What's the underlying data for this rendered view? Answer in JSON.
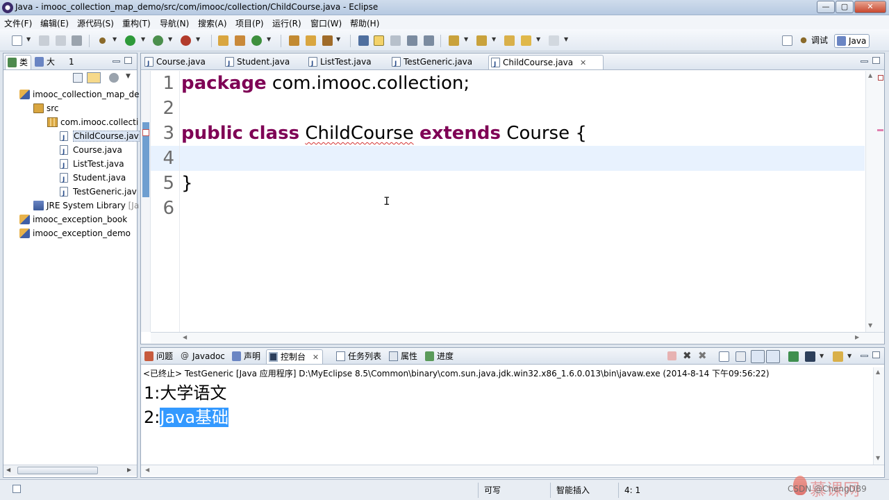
{
  "window": {
    "title": "Java - imooc_collection_map_demo/src/com/imooc/collection/ChildCourse.java - Eclipse",
    "buttons": {
      "minimize": "—",
      "maximize": "▢",
      "close": "✕"
    }
  },
  "menu": [
    "文件(F)",
    "编辑(E)",
    "源代码(S)",
    "重构(T)",
    "导航(N)",
    "搜索(A)",
    "项目(P)",
    "运行(R)",
    "窗口(W)",
    "帮助(H)"
  ],
  "perspectives": {
    "debug": "调试",
    "java": "Java"
  },
  "explorer": {
    "tabs": [
      "类",
      "大",
      "1"
    ],
    "tree": [
      {
        "label": "imooc_collection_map_de",
        "icon": "project-icon"
      },
      {
        "label": "src",
        "icon": "source-folder-icon"
      },
      {
        "label": "com.imooc.collecti",
        "icon": "package-icon"
      },
      {
        "label": "ChildCourse.jav",
        "icon": "java-file-icon",
        "selected": true
      },
      {
        "label": "Course.java",
        "icon": "java-file-icon"
      },
      {
        "label": "ListTest.java",
        "icon": "java-file-icon"
      },
      {
        "label": "Student.java",
        "icon": "java-file-icon"
      },
      {
        "label": "TestGeneric.jav",
        "icon": "java-file-icon"
      },
      {
        "label": "JRE System Library",
        "suffix": "[Ja",
        "icon": "library-icon"
      },
      {
        "label": "imooc_exception_book",
        "icon": "project-icon"
      },
      {
        "label": "imooc_exception_demo",
        "icon": "project-icon"
      }
    ]
  },
  "editor": {
    "tabs": [
      {
        "label": "Course.java"
      },
      {
        "label": "Student.java"
      },
      {
        "label": "ListTest.java"
      },
      {
        "label": "TestGeneric.java"
      },
      {
        "label": "ChildCourse.java",
        "active": true,
        "close": "✕"
      }
    ],
    "line_numbers": [
      "1",
      "2",
      "3",
      "4",
      "5",
      "6"
    ],
    "code": {
      "line1_kw": "package",
      "line1_rest": " com.imooc.collection;",
      "line3_kw1": "public",
      "line3_kw2": "class",
      "line3_name": "ChildCourse",
      "line3_kw3": "extends",
      "line3_rest": " Course {",
      "line5": "}"
    }
  },
  "console": {
    "tabs": [
      {
        "label": "问题"
      },
      {
        "label": "Javadoc"
      },
      {
        "label": "声明"
      },
      {
        "label": "控制台",
        "active": true,
        "close": "✕"
      },
      {
        "label": "任务列表"
      },
      {
        "label": "属性"
      },
      {
        "label": "进度"
      }
    ],
    "header": "<已终止> TestGeneric [Java 应用程序] D:\\MyEclipse 8.5\\Common\\binary\\com.sun.java.jdk.win32.x86_1.6.0.013\\bin\\javaw.exe (2014-8-14 下午09:56:22)",
    "lines": [
      {
        "prefix": "1:",
        "text": "大学语文"
      },
      {
        "prefix": "2:",
        "text": "Java基础",
        "selected": true
      }
    ]
  },
  "status": {
    "writable": "可写",
    "insert_mode": "智能插入",
    "position": "4: 1"
  },
  "watermark": {
    "logo": "慕课网",
    "credit": "CSDN @ChengDB9"
  },
  "colors": {
    "keyword": "#7f0055",
    "selection": "#3399ff",
    "current_line": "#e8f2fe"
  }
}
